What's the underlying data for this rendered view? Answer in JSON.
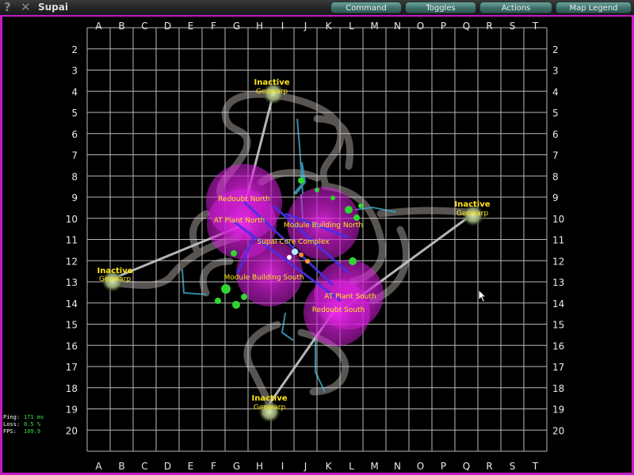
{
  "window": {
    "title": "Supai"
  },
  "titlebar": {
    "help_icon": "?",
    "close_icon": "✕"
  },
  "menu": {
    "command": "Command",
    "toggles": "Toggles",
    "actions": "Actions",
    "legend": "Map Legend"
  },
  "grid": {
    "columns": [
      "A",
      "B",
      "C",
      "D",
      "E",
      "F",
      "G",
      "H",
      "I",
      "J",
      "K",
      "L",
      "M",
      "N",
      "O",
      "P",
      "Q",
      "R",
      "S",
      "T"
    ],
    "rows": [
      "2",
      "3",
      "4",
      "5",
      "6",
      "7",
      "8",
      "9",
      "10",
      "11",
      "12",
      "13",
      "14",
      "15",
      "16",
      "17",
      "18",
      "19",
      "20"
    ]
  },
  "labels": {
    "core": "Supai Core Complex",
    "module_north": "Module Building North",
    "module_south": "Module Building South",
    "redoubt_north": "Redoubt North",
    "redoubt_south": "Redoubt South",
    "at_north": "AT Plant North",
    "at_south": "AT Plant South",
    "inactive": "Inactive",
    "geowarp": "Geowarp"
  },
  "stats": {
    "ping_label": "Ping:",
    "ping_value": "171 ms",
    "loss_label": "Loss:",
    "loss_value": "0.5 %",
    "fps_label": "FPS:",
    "fps_value": "109.9"
  },
  "colors": {
    "frame": "#c21cc7",
    "label": "#ffe61a",
    "stats_value": "#35e04a",
    "grid": "#d8d8d8"
  }
}
